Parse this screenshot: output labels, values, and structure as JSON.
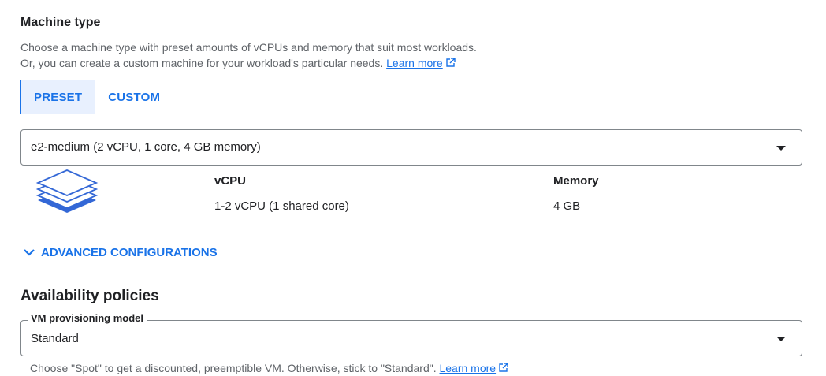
{
  "machine_type": {
    "title": "Machine type",
    "desc_line1": "Choose a machine type with preset amounts of vCPUs and memory that suit most workloads.",
    "desc_line2": "Or, you can create a custom machine for your workload's particular needs.",
    "learn_more": "Learn more",
    "tabs": [
      {
        "label": "PRESET",
        "selected": true
      },
      {
        "label": "CUSTOM",
        "selected": false
      }
    ],
    "select_value": "e2-medium (2 vCPU, 1 core, 4 GB memory)",
    "vcpu_header": "vCPU",
    "vcpu_value": "1-2 vCPU (1 shared core)",
    "memory_header": "Memory",
    "memory_value": "4 GB",
    "advanced_label": "ADVANCED CONFIGURATIONS"
  },
  "availability": {
    "title": "Availability policies",
    "provisioning_label": "VM provisioning model",
    "provisioning_value": "Standard",
    "help_text": "Choose \"Spot\" to get a discounted, preemptible VM. Otherwise, stick to \"Standard\".",
    "learn_more": "Learn more"
  },
  "colors": {
    "accent": "#1a73e8",
    "selected_bg": "#e8f0fe",
    "text": "#202124",
    "muted": "#5f6368"
  },
  "icons": [
    "external-link-icon",
    "stacked-layers-icon",
    "chevron-down-icon",
    "dropdown-caret-icon"
  ]
}
